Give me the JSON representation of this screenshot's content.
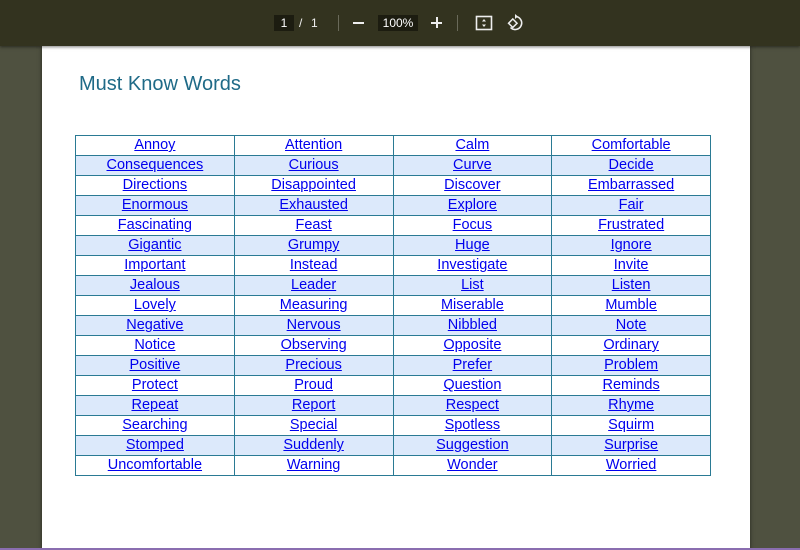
{
  "toolbar": {
    "current_page": "1",
    "page_separator": "/",
    "total_pages": "1",
    "zoom_level": "100%",
    "zoom_out_icon": "minus-icon",
    "zoom_in_icon": "plus-icon",
    "fit_icon": "fit-to-page-icon",
    "rotate_icon": "rotate-icon"
  },
  "document": {
    "title": "Must Know Words",
    "colors": {
      "title": "#1f6a87",
      "border": "#2a7a94",
      "stripe": "#dce9fb",
      "link": "#0000ee"
    },
    "rows": [
      [
        "Annoy",
        "Attention",
        "Calm",
        "Comfortable"
      ],
      [
        "Consequences",
        "Curious",
        "Curve",
        "Decide"
      ],
      [
        "Directions",
        "Disappointed",
        "Discover",
        "Embarrassed"
      ],
      [
        "Enormous",
        "Exhausted",
        "Explore",
        "Fair"
      ],
      [
        "Fascinating",
        "Feast",
        "Focus",
        "Frustrated"
      ],
      [
        "Gigantic",
        "Grumpy",
        "Huge",
        "Ignore"
      ],
      [
        "Important",
        "Instead",
        "Investigate",
        "Invite"
      ],
      [
        "Jealous",
        "Leader",
        "List",
        "Listen"
      ],
      [
        "Lovely",
        "Measuring",
        "Miserable",
        "Mumble"
      ],
      [
        "Negative",
        "Nervous",
        "Nibbled",
        "Note"
      ],
      [
        "Notice",
        "Observing",
        "Opposite",
        "Ordinary"
      ],
      [
        "Positive",
        "Precious",
        "Prefer",
        "Problem"
      ],
      [
        "Protect",
        "Proud",
        "Question",
        "Reminds"
      ],
      [
        "Repeat",
        "Report",
        "Respect",
        "Rhyme"
      ],
      [
        "Searching",
        "Special",
        "Spotless",
        "Squirm"
      ],
      [
        "Stomped",
        "Suddenly",
        "Suggestion",
        "Surprise"
      ],
      [
        "Uncomfortable",
        "Warning",
        "Wonder",
        "Worried"
      ]
    ]
  }
}
